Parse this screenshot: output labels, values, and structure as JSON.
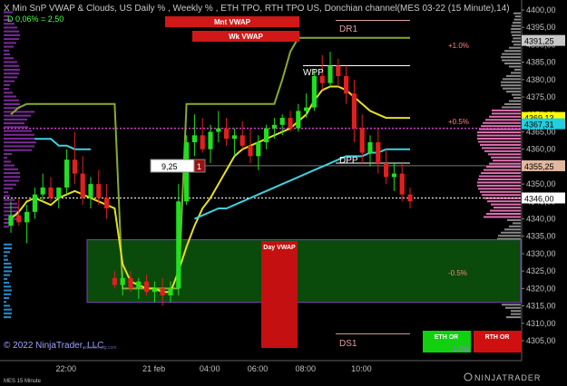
{
  "header": {
    "title": "X Min SnP VWAP & Clouds, US Daily % , Weekly % , ETH TPO, RTH TPO US, Donchian channel(MES 03-22 (15 Minute),14)",
    "sub": "D 0,06% = 2,50"
  },
  "buttons": {
    "mnt_vwap": "Mnt VWAP",
    "wk_vwap": "Wk VWAP",
    "day_vwap": "Day VWAP",
    "eth_or": "ETH OR",
    "rth_or": "RTH OR"
  },
  "labels": {
    "dr1": "DR1",
    "ds1": "DS1",
    "dpp": "DPP",
    "wpp": "WPP",
    "plus1": "+1.0%",
    "plus05": "+0.5%",
    "minus05": "-0.5%",
    "minus1": "-1.0%",
    "order_qty": "9,25",
    "order_side": "1",
    "copyright": "© 2022 NinjaTrader, LLC",
    "instrument": "MES 15 Minute",
    "logo": "NINJATRADER",
    "watermark": "www.fin-alg.com"
  },
  "price_badges": [
    {
      "value": "4391,25",
      "bg": "#c8c8c8",
      "fg": "#000000"
    },
    {
      "value": "4369,13",
      "bg": "#ffff00",
      "fg": "#000000"
    },
    {
      "value": "4367,31",
      "bg": "#20d0e0",
      "fg": "#000000"
    },
    {
      "value": "4355,25",
      "bg": "#e0b8a0",
      "fg": "#000000"
    },
    {
      "value": "4346,00",
      "bg": "#ffffff",
      "fg": "#000000"
    }
  ],
  "chart_data": {
    "type": "candlestick",
    "instrument": "MES 03-22",
    "timeframe": "15 Minute",
    "y_ticks": [
      4305,
      4310,
      4315,
      4320,
      4325,
      4330,
      4335,
      4340,
      4345,
      4350,
      4355,
      4360,
      4365,
      4370,
      4375,
      4380,
      4385,
      4390,
      4395,
      4400
    ],
    "y_tick_labels": [
      "4305,00",
      "4310,00",
      "4315,00",
      "4320,00",
      "4325,00",
      "4330,00",
      "4335,00",
      "4340,00",
      "4345,00",
      "4350,00",
      "4355,00",
      "4360,00",
      "4365,00",
      "4370,00",
      "4375,00",
      "4380,00",
      "4385,00",
      "4390,00",
      "4395,00",
      "4400,00"
    ],
    "ylim": [
      4302,
      4402
    ],
    "x_tick_labels": [
      "22:00",
      "21 feb",
      "04:00",
      "06:00",
      "08:00",
      "10:00"
    ],
    "candles": [
      [
        4338,
        4345,
        4336,
        4341
      ],
      [
        4341,
        4346,
        4338,
        4339
      ],
      [
        4339,
        4344,
        4333,
        4342
      ],
      [
        4342,
        4349,
        4340,
        4347
      ],
      [
        4347,
        4353,
        4345,
        4349
      ],
      [
        4349,
        4352,
        4345,
        4346
      ],
      [
        4346,
        4349,
        4343,
        4349
      ],
      [
        4349,
        4360,
        4347,
        4357
      ],
      [
        4357,
        4365,
        4350,
        4353
      ],
      [
        4353,
        4358,
        4344,
        4346
      ],
      [
        4346,
        4352,
        4343,
        4350
      ],
      [
        4350,
        4354,
        4344,
        4346
      ],
      [
        4346,
        4350,
        4340,
        4343
      ],
      [
        4323,
        4325,
        4320,
        4321
      ],
      [
        4321,
        4325,
        4318,
        4323
      ],
      [
        4323,
        4325,
        4319,
        4320
      ],
      [
        4320,
        4323,
        4317,
        4322
      ],
      [
        4322,
        4324,
        4318,
        4319
      ],
      [
        4319,
        4322,
        4316,
        4320
      ],
      [
        4320,
        4323,
        4315,
        4318
      ],
      [
        4318,
        4322,
        4316,
        4320
      ],
      [
        4320,
        4350,
        4318,
        4345
      ],
      [
        4345,
        4364,
        4344,
        4362
      ],
      [
        4362,
        4370,
        4358,
        4364
      ],
      [
        4364,
        4369,
        4359,
        4360
      ],
      [
        4360,
        4367,
        4356,
        4365
      ],
      [
        4365,
        4371,
        4362,
        4366
      ],
      [
        4366,
        4369,
        4361,
        4363
      ],
      [
        4363,
        4366,
        4358,
        4364
      ],
      [
        4364,
        4368,
        4360,
        4361
      ],
      [
        4361,
        4366,
        4356,
        4358
      ],
      [
        4358,
        4364,
        4354,
        4362
      ],
      [
        4362,
        4367,
        4360,
        4366
      ],
      [
        4366,
        4369,
        4363,
        4367
      ],
      [
        4367,
        4370,
        4364,
        4369
      ],
      [
        4369,
        4371,
        4365,
        4366
      ],
      [
        4366,
        4373,
        4365,
        4371
      ],
      [
        4371,
        4376,
        4369,
        4372
      ],
      [
        4372,
        4383,
        4371,
        4381
      ],
      [
        4381,
        4387,
        4377,
        4379
      ],
      [
        4379,
        4388,
        4378,
        4384
      ],
      [
        4384,
        4386,
        4378,
        4381
      ],
      [
        4381,
        4384,
        4373,
        4376
      ],
      [
        4376,
        4380,
        4362,
        4366
      ],
      [
        4366,
        4370,
        4356,
        4359
      ],
      [
        4359,
        4364,
        4355,
        4362
      ],
      [
        4362,
        4366,
        4353,
        4356
      ],
      [
        4356,
        4360,
        4350,
        4352
      ],
      [
        4352,
        4356,
        4348,
        4353
      ],
      [
        4353,
        4356,
        4345,
        4347
      ],
      [
        4347,
        4349,
        4343,
        4345
      ]
    ],
    "series": [
      {
        "name": "Mnt VWAP",
        "color": "#88aa30",
        "values": [
          4370,
          4372,
          4373,
          4373,
          4373,
          4373,
          4373,
          4373,
          4373,
          4373,
          4373,
          4373,
          4373,
          4373,
          4320,
          4320,
          4320,
          4320,
          4320,
          4320,
          4320,
          4320,
          4373,
          4373,
          4373,
          4373,
          4373,
          4373,
          4373,
          4373,
          4373,
          4373,
          4373,
          4373,
          4380,
          4388,
          4392,
          4392,
          4392,
          4392,
          4392,
          4392,
          4392,
          4392,
          4392,
          4392,
          4392,
          4392,
          4392,
          4392,
          4392
        ]
      },
      {
        "name": "Day VWAP",
        "color": "#e8e020",
        "values": [
          4340,
          4342,
          4345,
          4346,
          4345,
          4344,
          4346,
          4347,
          4348,
          4347,
          4346,
          4345,
          4344,
          4343,
          4327,
          4322,
          4321,
          4320,
          4320,
          4319,
          4319,
          4325,
          4332,
          4338,
          4343,
          4346,
          4350,
          4354,
          4358,
          4360,
          4361,
          4362,
          4363,
          4364,
          4365,
          4366,
          4368,
          4370,
          4374,
          4377,
          4378,
          4378,
          4377,
          4375,
          4373,
          4371,
          4370,
          4369,
          4369,
          4369,
          4369
        ]
      },
      {
        "name": "Wk VWAP",
        "color": "#40d0e0",
        "values": [
          null,
          null,
          null,
          4363,
          4363,
          4363,
          4361,
          4361,
          4360,
          4360,
          4360,
          null,
          null,
          null,
          null,
          null,
          null,
          null,
          null,
          null,
          null,
          null,
          null,
          4340,
          4341,
          4342,
          4343,
          4343,
          4344,
          4345,
          4346,
          4347,
          4348,
          4349,
          4350,
          4351,
          4352,
          4353,
          4354,
          4355,
          4356,
          4357,
          4358,
          4358,
          4358,
          4359,
          4359,
          4360,
          4360,
          4360,
          4360
        ]
      }
    ],
    "levels": [
      {
        "name": "DR1",
        "value": 4397
      },
      {
        "name": "WPP",
        "value": 4384
      },
      {
        "name": "DPP",
        "value": 4356
      },
      {
        "name": "DS1",
        "value": 4307
      },
      {
        "name": "+1.0%",
        "value": 4391
      },
      {
        "name": "+0.5%",
        "value": 4366
      },
      {
        "name": "-0.5%",
        "value": 4320
      },
      {
        "name": "current",
        "value": 4346
      }
    ],
    "green_zone": [
      4316,
      4334
    ],
    "day_vwap_box": [
      4305,
      4334
    ]
  },
  "colors": {
    "bg": "#000000",
    "up": "#20e020",
    "down": "#e02020",
    "axis_text": "#c0c0c0",
    "magenta_dotted": "#d040d0",
    "zone": "#0a4a0a"
  }
}
